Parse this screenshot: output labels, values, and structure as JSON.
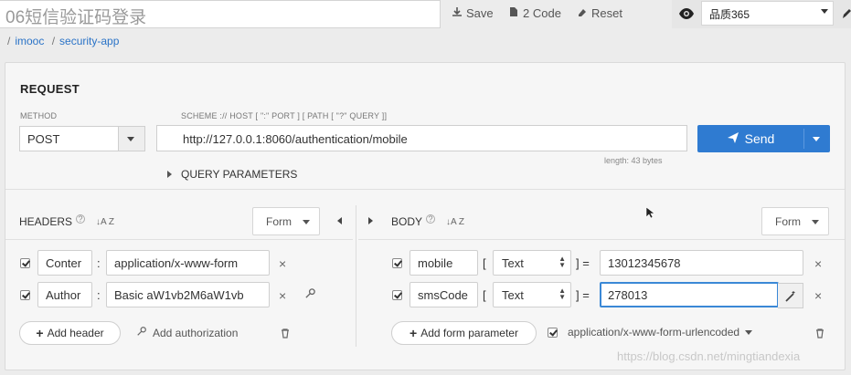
{
  "toolbar": {
    "title": "06短信验证码登录",
    "save_label": "Save",
    "code_label": "2 Code",
    "reset_label": "Reset",
    "environment": "品质365"
  },
  "breadcrumb": [
    "imooc",
    "security-app"
  ],
  "request": {
    "section_title": "REQUEST",
    "method_label": "METHOD",
    "method_value": "POST",
    "url_label": "SCHEME :// HOST [ \":\" PORT ] [ PATH [ \"?\" QUERY ]]",
    "url_value": "http://127.0.0.1:8060/authentication/mobile",
    "length_text": "length: 43 bytes",
    "send_label": "Send",
    "query_params_label": "QUERY PARAMETERS"
  },
  "headers": {
    "title": "HEADERS",
    "help": "?",
    "sort": "↓A Z",
    "form_label": "Form",
    "rows": [
      {
        "name": "Conter",
        "value": "application/x-www-form"
      },
      {
        "name": "Author",
        "value": "Basic aW1vb2M6aW1vb"
      }
    ],
    "add_label": "Add header",
    "auth_label": "Add authorization"
  },
  "body": {
    "title": "BODY",
    "help": "?",
    "sort": "↓A Z",
    "form_label": "Form",
    "rows": [
      {
        "name": "mobile",
        "type": "Text",
        "value": "13012345678"
      },
      {
        "name": "smsCode",
        "type": "Text",
        "value": "278013"
      }
    ],
    "add_label": "Add form parameter",
    "encoding": "application/x-www-form-urlencoded"
  },
  "watermark": "https://blog.csdn.net/mingtiandexia"
}
